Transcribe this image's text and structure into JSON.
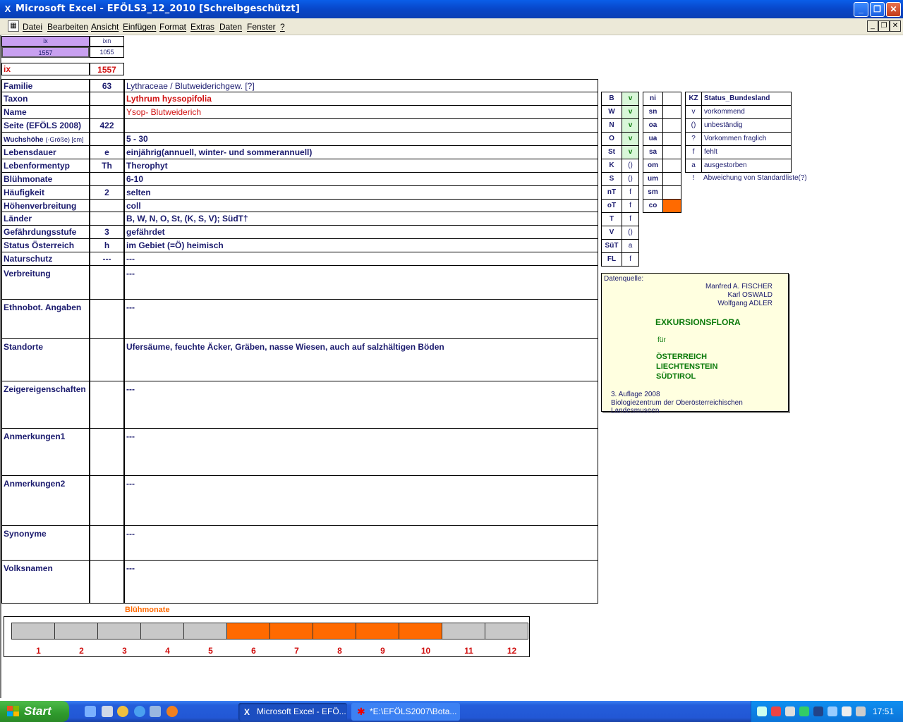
{
  "window": {
    "title": "Microsoft Excel - EFÖLS3_12_2010  [Schreibgeschützt]"
  },
  "menu": [
    "Datei",
    "Bearbeiten",
    "Ansicht",
    "Einfügen",
    "Format",
    "Extras",
    "Daten",
    "Fenster",
    "?"
  ],
  "topcells": {
    "ix_head": "ix",
    "ixn_head": "ixn",
    "ix_val": "1557",
    "ixn_val": "1055",
    "ix_label": "ix",
    "ix_value": "1557"
  },
  "rows": [
    {
      "label": "Familie",
      "num": "63",
      "value": "Lythraceae  /  Blutweiderichgew. [?]"
    },
    {
      "label": "Taxon",
      "num": "",
      "value": "Lythrum hyssopifolia"
    },
    {
      "label": "Name",
      "num": "",
      "value": "Ysop- Blutweiderich"
    },
    {
      "label": "Seite (EFÖLS 2008)",
      "num": "422",
      "value": ""
    },
    {
      "label": "Wuchshöhe",
      "label_small": "(-Größe) [cm]",
      "num": "",
      "value": "5 - 30"
    },
    {
      "label": "Lebensdauer",
      "num": "e",
      "value": "einjährig(annuell, winter- und sommerannuell)"
    },
    {
      "label": "Lebenformentyp",
      "num": "Th",
      "value": "Therophyt"
    },
    {
      "label": "Blühmonate",
      "num": "",
      "value": "6-10"
    },
    {
      "label": "Häufigkeit",
      "num": "2",
      "value": "selten"
    },
    {
      "label": "Höhenverbreitung",
      "num": "",
      "value": "coll"
    },
    {
      "label": "Länder",
      "num": "",
      "value": "B, W, N, O, St, (K, S, V); SüdT†"
    },
    {
      "label": "Gefährdungsstufe",
      "num": "3",
      "value": "gefährdet"
    },
    {
      "label": "Status Österreich",
      "num": "h",
      "value": "im Gebiet (=Ö) heimisch"
    },
    {
      "label": "Naturschutz",
      "num": "---",
      "value": "---"
    }
  ],
  "bigrows": [
    {
      "label": "Verbreitung",
      "value": "---"
    },
    {
      "label": "Ethnobot. Angaben",
      "value": "---"
    },
    {
      "label": "Standorte",
      "value": "Ufersäume, feuchte Äcker, Gräben, nasse Wiesen, auch auf salzhältigen Böden"
    },
    {
      "label": "Zeigereigenschaften",
      "value": "---"
    },
    {
      "label": "Anmerkungen1",
      "value": "---"
    },
    {
      "label": "Anmerkungen2",
      "value": "---"
    },
    {
      "label": "Synonyme",
      "value": "---"
    },
    {
      "label": "Volksnamen",
      "value": "---"
    }
  ],
  "laender": [
    {
      "k": "B",
      "v": "v"
    },
    {
      "k": "W",
      "v": "v"
    },
    {
      "k": "N",
      "v": "v"
    },
    {
      "k": "O",
      "v": "v"
    },
    {
      "k": "St",
      "v": "v"
    },
    {
      "k": "K",
      "v": "()"
    },
    {
      "k": "S",
      "v": "()"
    },
    {
      "k": "nT",
      "v": "f"
    },
    {
      "k": "oT",
      "v": "f"
    },
    {
      "k": "T",
      "v": "f"
    },
    {
      "k": "V",
      "v": "()"
    },
    {
      "k": "SüT",
      "v": "a"
    },
    {
      "k": "FL",
      "v": "f"
    }
  ],
  "hoehen": [
    "ni",
    "sn",
    "oa",
    "ua",
    "sa",
    "om",
    "um",
    "sm",
    "co"
  ],
  "legend": {
    "head_kz": "KZ",
    "head_status": "Status_Bundesland",
    "items": [
      {
        "k": "v",
        "t": "vorkommend"
      },
      {
        "k": "()",
        "t": "unbeständig"
      },
      {
        "k": "?",
        "t": "Vorkommen fraglich"
      },
      {
        "k": "f",
        "t": "fehlt"
      },
      {
        "k": "a",
        "t": "ausgestorben"
      },
      {
        "k": "!",
        "t": "Abweichung von Standardliste(?)"
      }
    ]
  },
  "book": {
    "quelle": "Datenquelle:",
    "a1": "Manfred A. FISCHER",
    "a2": "Karl OSWALD",
    "a3": "Wolfgang ADLER",
    "title": "EXKURSIONSFLORA",
    "fuer": "für",
    "c1": "ÖSTERREICH",
    "c2": "LIECHTENSTEIN",
    "c3": "SÜDTIROL",
    "ed": "3. Auflage 2008",
    "pub": "Biologiezentrum der Oberösterreichischen Landesmuseen"
  },
  "chart_data": {
    "type": "bar",
    "title": "Blühmonate",
    "categories": [
      "1",
      "2",
      "3",
      "4",
      "5",
      "6",
      "7",
      "8",
      "9",
      "10",
      "11",
      "12"
    ],
    "values": [
      0,
      0,
      0,
      0,
      0,
      1,
      1,
      1,
      1,
      1,
      0,
      0
    ],
    "colors": {
      "active": "#ff6a00",
      "inactive": "#c8c8c8"
    }
  },
  "taskbar": {
    "start": "Start",
    "task1": "Microsoft Excel - EFÖ...",
    "task2": "*E:\\EFÖLS2007\\Bota...",
    "clock": "17:51"
  },
  "colors": {
    "accent_orange": "#ff6a00",
    "header_purple": "#c8a0f0",
    "label_blue": "#1b1b6e",
    "red": "#d01010",
    "green": "#0b7a0b"
  }
}
